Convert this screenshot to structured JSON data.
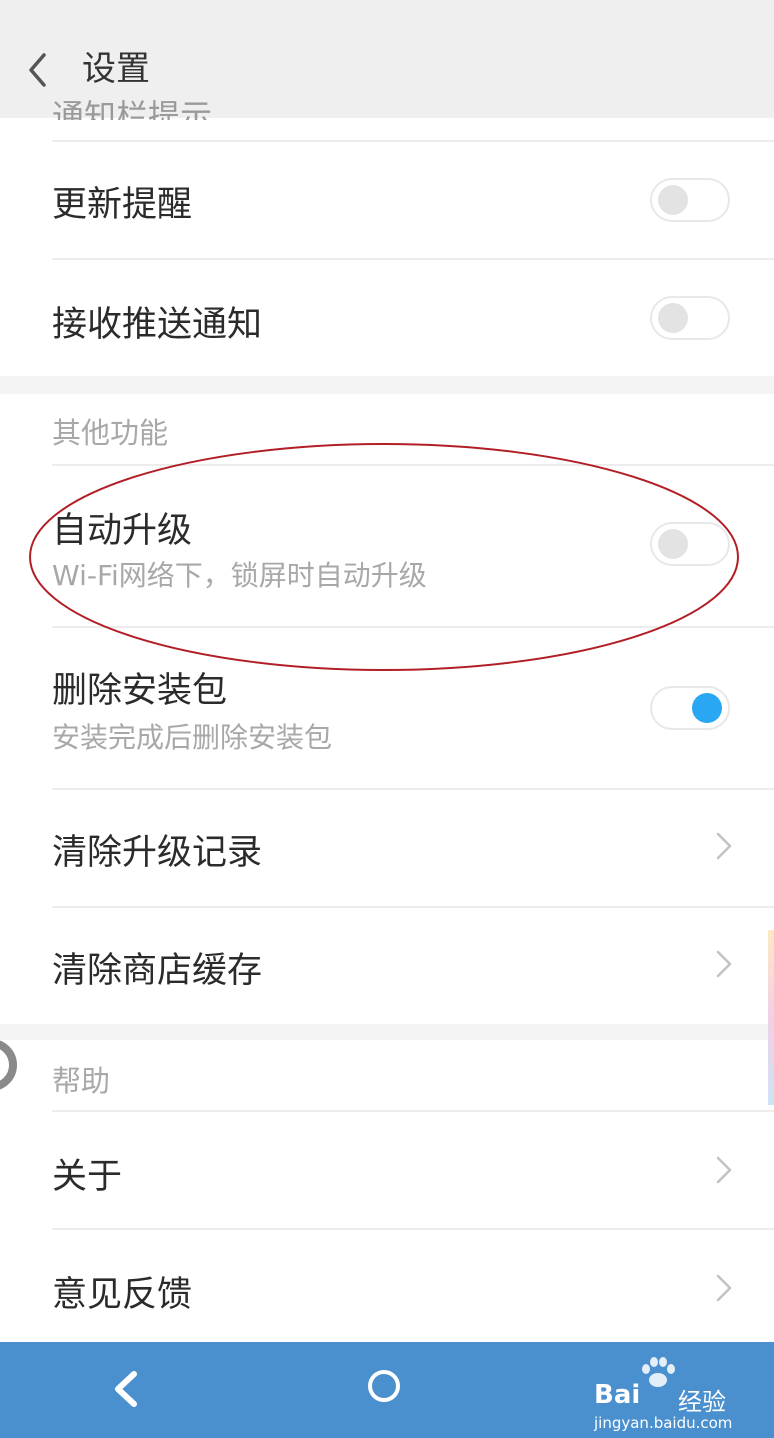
{
  "header": {
    "title": "设置"
  },
  "notifications": {
    "peek_label": "通知栏提示",
    "items": [
      {
        "label": "更新提醒",
        "toggle_on": false
      },
      {
        "label": "接收推送通知",
        "toggle_on": false
      }
    ]
  },
  "other": {
    "header": "其他功能",
    "auto_upgrade": {
      "label": "自动升级",
      "subtitle": "Wi-Fi网络下，锁屏时自动升级",
      "toggle_on": false
    },
    "delete_package": {
      "label": "删除安装包",
      "subtitle": "安装完成后删除安装包",
      "toggle_on": true
    },
    "clear_records": {
      "label": "清除升级记录"
    },
    "clear_cache": {
      "label": "清除商店缓存"
    }
  },
  "help": {
    "header": "帮助",
    "about": {
      "label": "关于"
    },
    "feedback": {
      "label": "意见反馈"
    }
  },
  "navbar": {
    "watermark_brand": "Bai",
    "watermark_product": "经验",
    "watermark_url": "jingyan.baidu.com"
  },
  "colors": {
    "toggle_on": "#2aa7f3",
    "navbar": "#4a8fce",
    "annotation": "#b21e26"
  },
  "icons": {
    "back": "chevron-left-icon",
    "row_arrow": "chevron-right-icon",
    "home": "circle-home-icon"
  }
}
